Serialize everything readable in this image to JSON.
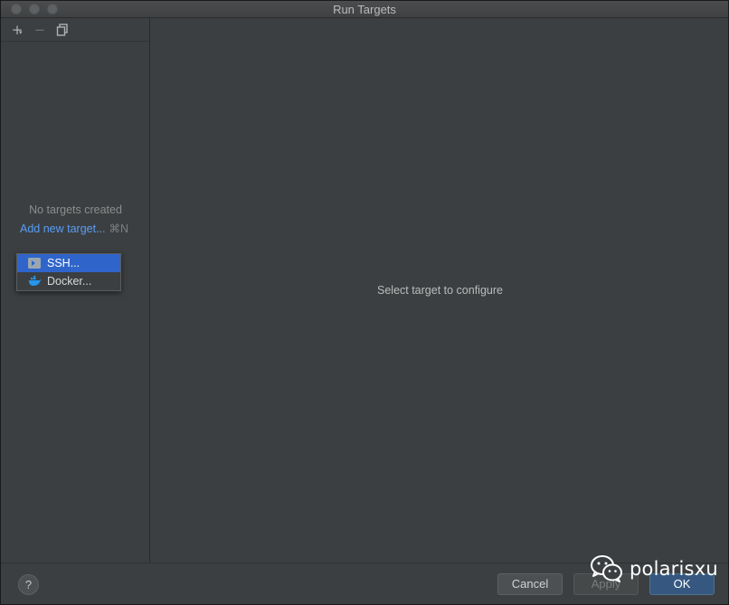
{
  "window": {
    "title": "Run Targets"
  },
  "toolbar": {
    "add_icon": "plus-icon",
    "remove_icon": "minus-icon",
    "copy_icon": "copy-icon"
  },
  "left_panel": {
    "empty_text": "No targets created",
    "add_link": "Add new target...",
    "add_shortcut": "⌘N"
  },
  "popup": {
    "items": [
      {
        "label": "SSH...",
        "icon": "ssh-terminal-icon",
        "selected": true
      },
      {
        "label": "Docker...",
        "icon": "docker-icon",
        "selected": false
      }
    ]
  },
  "right_panel": {
    "placeholder": "Select target to configure"
  },
  "footer": {
    "help_label": "?",
    "cancel_label": "Cancel",
    "apply_label": "Apply",
    "ok_label": "OK"
  },
  "watermark": {
    "text": "polarisxu"
  },
  "colors": {
    "background": "#3c3f41",
    "link": "#589df6",
    "selection": "#2f65ca",
    "ok_button": "#365880"
  }
}
